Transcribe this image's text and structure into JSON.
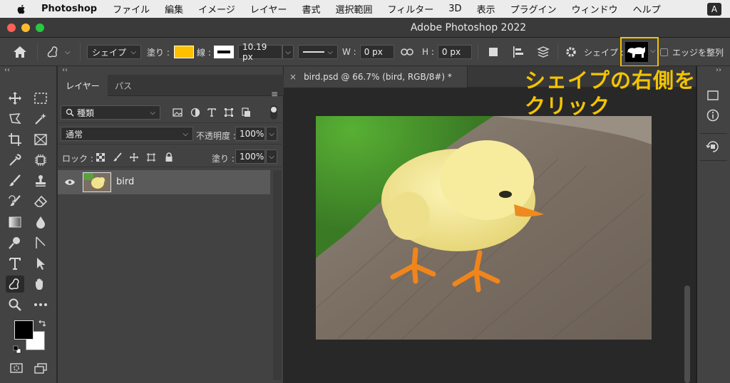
{
  "menubar": {
    "app_name": "Photoshop",
    "items": [
      "ファイル",
      "編集",
      "イメージ",
      "レイヤー",
      "書式",
      "選択範囲",
      "フィルター",
      "3D",
      "表示",
      "プラグイン",
      "ウィンドウ",
      "ヘルプ"
    ],
    "input_indicator": "A"
  },
  "window": {
    "title": "Adobe Photoshop 2022"
  },
  "options": {
    "mode_label": "シェイプ",
    "fill_label": "塗り :",
    "fill_color": "#ffc000",
    "stroke_label": "線 :",
    "stroke_width": "10.19 px",
    "w_label": "W :",
    "w_value": "0 px",
    "h_label": "H :",
    "h_value": "0 px",
    "shape_label": "シェイプ :",
    "align_edges_label": "エッジを整列"
  },
  "layers_panel": {
    "tabs": [
      "レイヤー",
      "パス"
    ],
    "filter_kind": "種類",
    "blend_mode": "通常",
    "opacity_label": "不透明度 :",
    "opacity_value": "100%",
    "lock_label": "ロック :",
    "fill_label": "塗り :",
    "fill_value": "100%",
    "layers": [
      {
        "name": "bird"
      }
    ]
  },
  "document": {
    "tab_title": "bird.psd @ 66.7% (bird, RGB/8#) *",
    "close_glyph": "×"
  },
  "annotation": {
    "line1": "シェイプの右側を",
    "line2": "クリック",
    "color": "#f4c400"
  }
}
